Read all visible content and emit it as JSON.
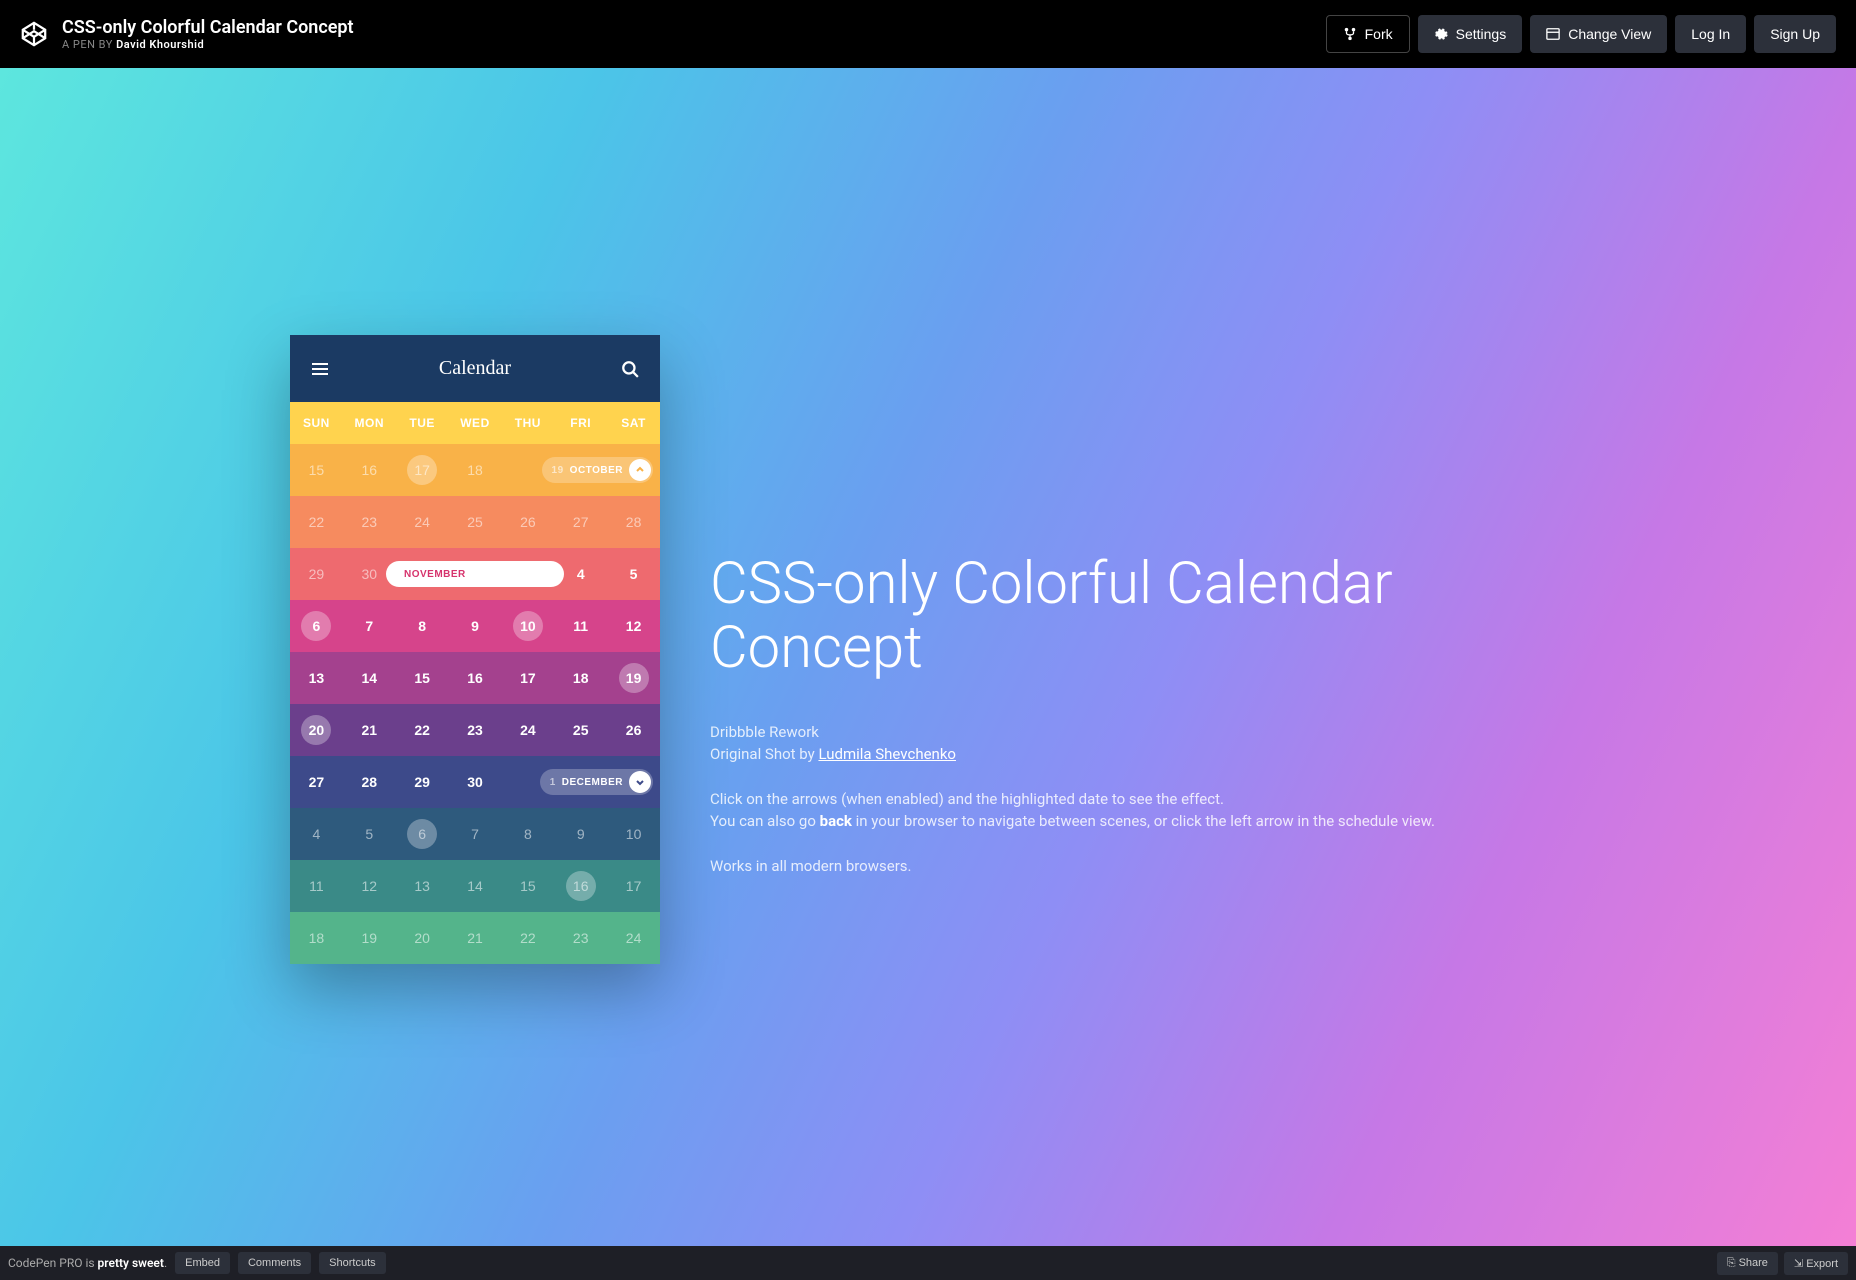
{
  "header": {
    "title": "CSS-only Colorful Calendar Concept",
    "byline_prefix": "A PEN BY ",
    "author": "David Khourshid",
    "buttons": {
      "fork": "Fork",
      "settings": "Settings",
      "change_view": "Change View",
      "login": "Log In",
      "signup": "Sign Up"
    }
  },
  "calendar": {
    "title": "Calendar",
    "dow": [
      "SUN",
      "MON",
      "TUE",
      "WED",
      "THU",
      "FRI",
      "SAT"
    ],
    "prev_month_label": "OCTOBER",
    "prev_month_lead": "19",
    "current_month_label": "NOVEMBER",
    "next_month_label": "DECEMBER",
    "next_month_lead": "1",
    "weeks": [
      {
        "cls": "w0",
        "days": [
          {
            "n": "15",
            "m": true
          },
          {
            "n": "16",
            "m": true
          },
          {
            "n": "17",
            "m": true,
            "dot": true
          },
          {
            "n": "18",
            "m": true
          },
          {
            "n": "",
            "m": true
          },
          {
            "n": "",
            "m": true
          },
          {
            "n": "",
            "m": true
          }
        ],
        "pill": "prev"
      },
      {
        "cls": "w1",
        "days": [
          {
            "n": "22",
            "m": true
          },
          {
            "n": "23",
            "m": true
          },
          {
            "n": "24",
            "m": true
          },
          {
            "n": "25",
            "m": true
          },
          {
            "n": "26",
            "m": true
          },
          {
            "n": "27",
            "m": true
          },
          {
            "n": "28",
            "m": true
          }
        ]
      },
      {
        "cls": "w2",
        "days": [
          {
            "n": "29",
            "m": true
          },
          {
            "n": "30",
            "m": true
          },
          {
            "n": ""
          },
          {
            "n": ""
          },
          {
            "n": ""
          },
          {
            "n": "4"
          },
          {
            "n": "5"
          }
        ],
        "pill": "current"
      },
      {
        "cls": "w3",
        "days": [
          {
            "n": "6",
            "dot": true
          },
          {
            "n": "7"
          },
          {
            "n": "8"
          },
          {
            "n": "9"
          },
          {
            "n": "10",
            "dot": true
          },
          {
            "n": "11"
          },
          {
            "n": "12"
          }
        ]
      },
      {
        "cls": "w4",
        "days": [
          {
            "n": "13"
          },
          {
            "n": "14"
          },
          {
            "n": "15"
          },
          {
            "n": "16"
          },
          {
            "n": "17"
          },
          {
            "n": "18"
          },
          {
            "n": "19",
            "dot": true
          }
        ]
      },
      {
        "cls": "w5",
        "days": [
          {
            "n": "20",
            "dot": true
          },
          {
            "n": "21"
          },
          {
            "n": "22"
          },
          {
            "n": "23"
          },
          {
            "n": "24"
          },
          {
            "n": "25"
          },
          {
            "n": "26"
          }
        ]
      },
      {
        "cls": "w6",
        "days": [
          {
            "n": "27"
          },
          {
            "n": "28"
          },
          {
            "n": "29"
          },
          {
            "n": "30"
          },
          {
            "n": ""
          },
          {
            "n": ""
          },
          {
            "n": ""
          }
        ],
        "pill": "next"
      },
      {
        "cls": "w7",
        "days": [
          {
            "n": "4",
            "m": true
          },
          {
            "n": "5",
            "m": true
          },
          {
            "n": "6",
            "m": true,
            "dot": true
          },
          {
            "n": "7",
            "m": true
          },
          {
            "n": "8",
            "m": true
          },
          {
            "n": "9",
            "m": true
          },
          {
            "n": "10",
            "m": true
          }
        ]
      },
      {
        "cls": "w8",
        "days": [
          {
            "n": "11",
            "m": true
          },
          {
            "n": "12",
            "m": true
          },
          {
            "n": "13",
            "m": true
          },
          {
            "n": "14",
            "m": true
          },
          {
            "n": "15",
            "m": true
          },
          {
            "n": "16",
            "m": true,
            "dot": true
          },
          {
            "n": "17",
            "m": true
          }
        ]
      },
      {
        "cls": "w9",
        "days": [
          {
            "n": "18",
            "m": true
          },
          {
            "n": "19",
            "m": true
          },
          {
            "n": "20",
            "m": true
          },
          {
            "n": "21",
            "m": true
          },
          {
            "n": "22",
            "m": true
          },
          {
            "n": "23",
            "m": true
          },
          {
            "n": "24",
            "m": true
          }
        ]
      }
    ]
  },
  "description": {
    "heading": "CSS-only Colorful Calendar Concept",
    "line1a": "Dribbble Rework",
    "line1b": "Original Shot by ",
    "line1_link": "Ludmila Shevchenko",
    "line2a": "Click on the arrows (when enabled) and the highlighted date to see the effect.",
    "line2b_pre": "You can also go ",
    "line2b_strong": "back",
    "line2b_post": " in your browser to navigate between scenes, or click the left arrow in the schedule view.",
    "line3": "Works in all modern browsers."
  },
  "footer": {
    "msg_pre": "CodePen PRO is ",
    "msg_strong": "pretty sweet",
    "msg_post": ".",
    "embed": "Embed",
    "comments": "Comments",
    "shortcuts": "Shortcuts",
    "share": "Share",
    "export": "Export"
  }
}
